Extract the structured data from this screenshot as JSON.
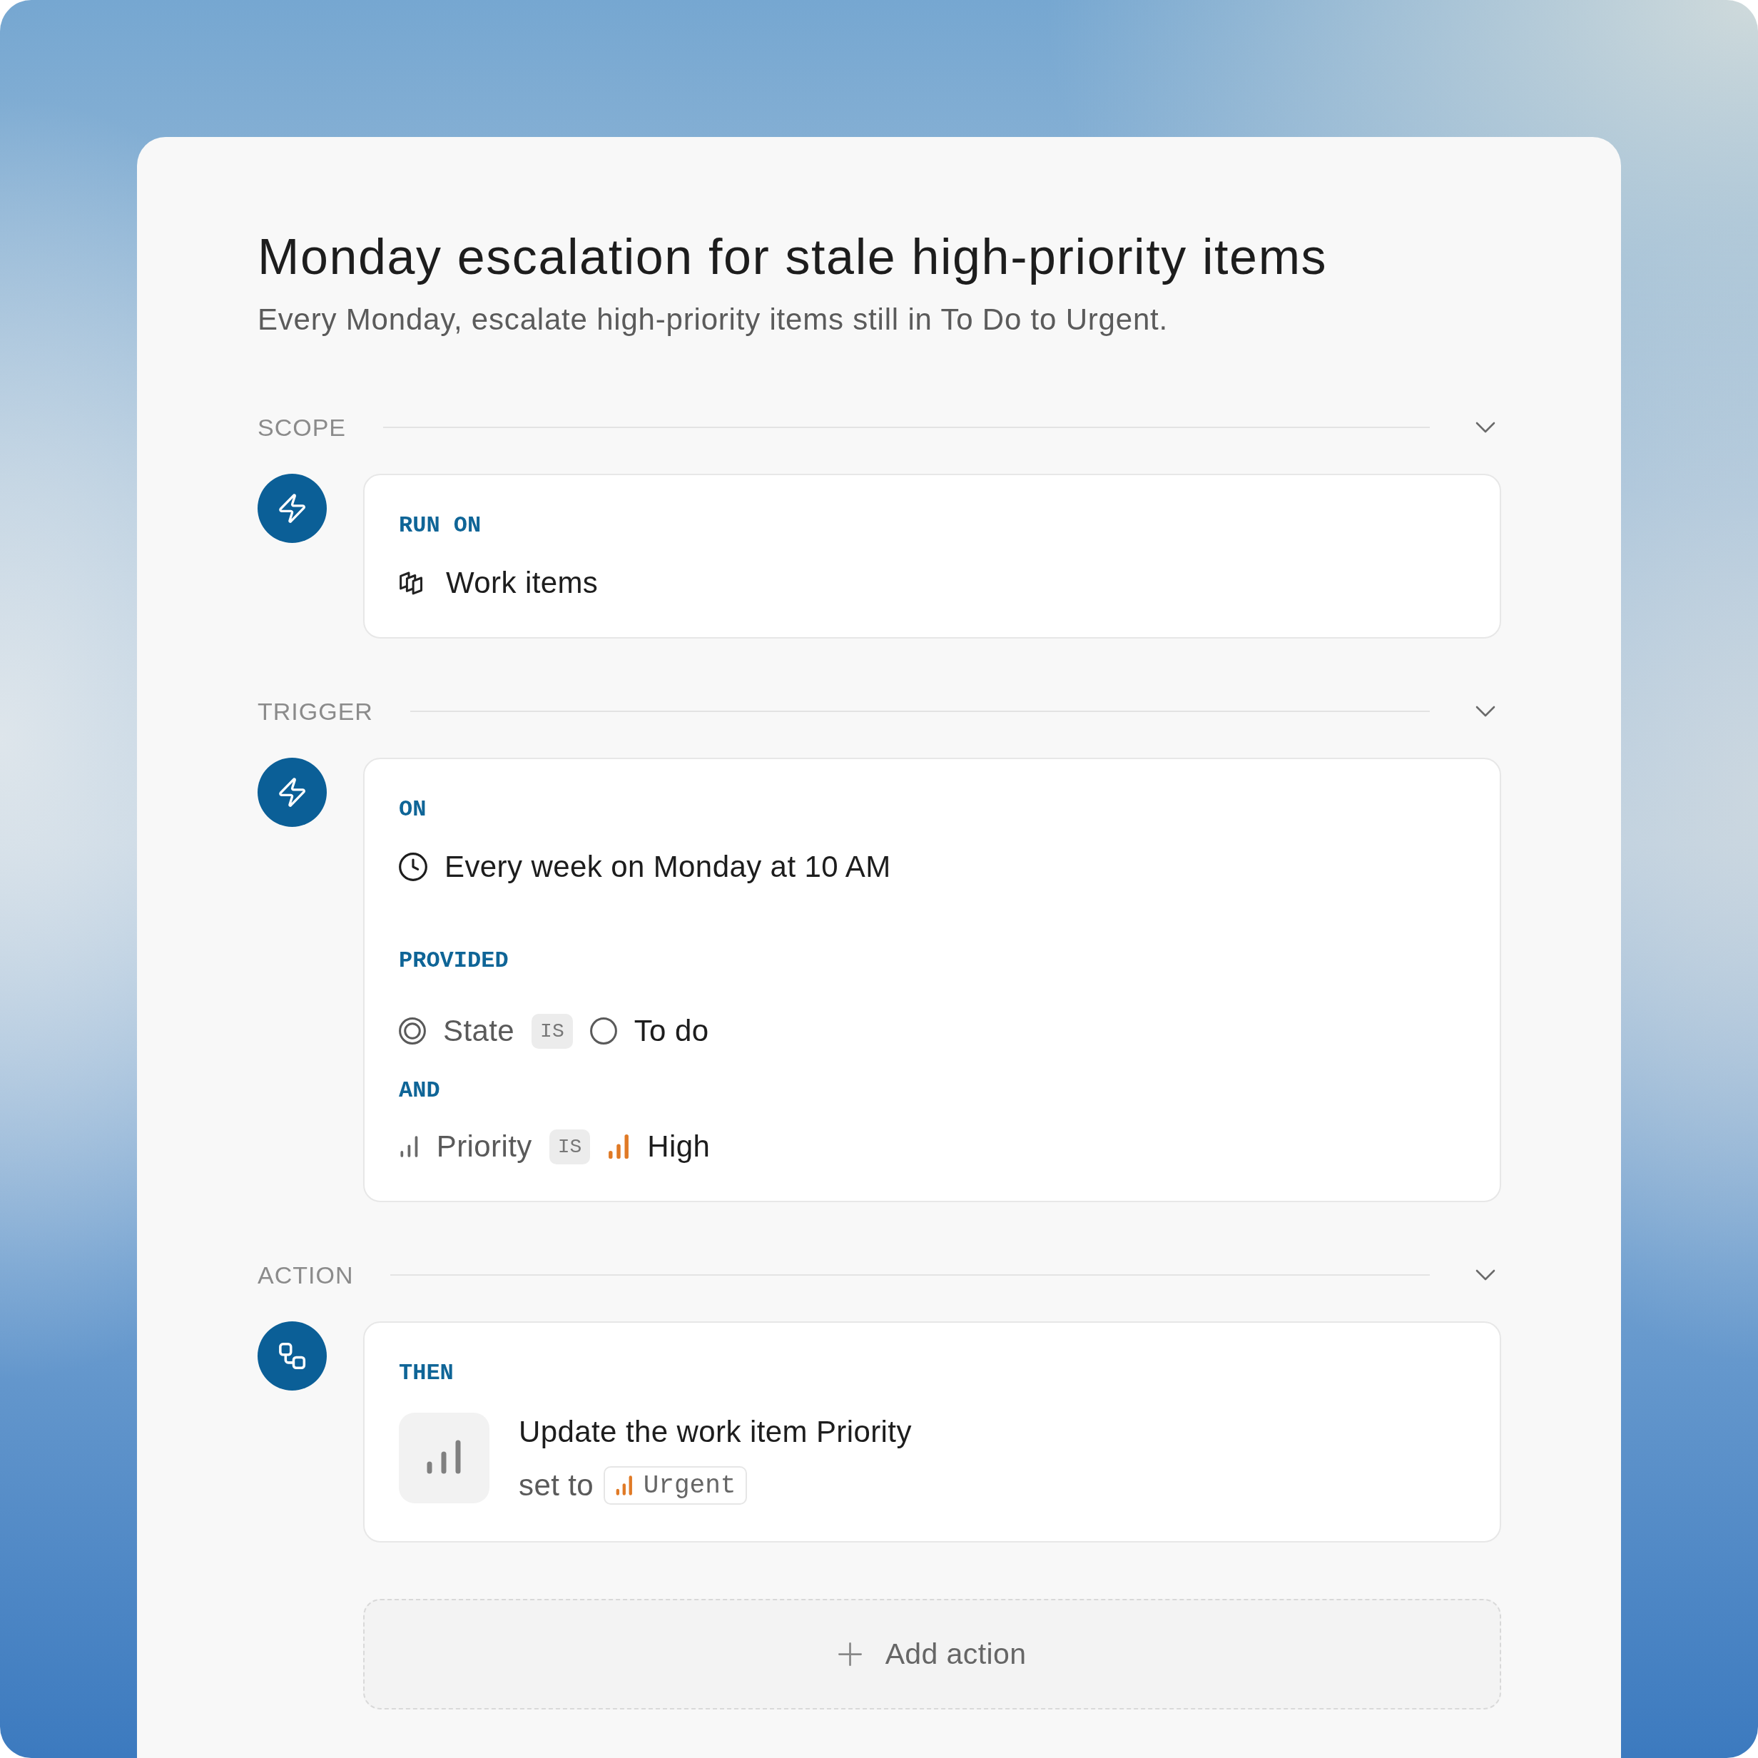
{
  "automation": {
    "title": "Monday escalation for stale high-priority items",
    "description": "Every Monday, escalate high-priority items still in To Do to Urgent."
  },
  "sections": [
    {
      "kind": "scope",
      "heading": "SCOPE",
      "expanded": true,
      "label": "RUN ON",
      "value": "Work items"
    },
    {
      "kind": "trigger",
      "heading": "TRIGGER",
      "expanded": true,
      "label": "ON",
      "schedule": "Every week on Monday at 10 AM",
      "conditions_label": "PROVIDED",
      "conditions": [
        {
          "kind": "state",
          "property": "State",
          "operator": "IS",
          "value": "To do"
        },
        {
          "kind": "priority",
          "joiner": "AND",
          "property": "Priority",
          "operator": "IS",
          "value": "High"
        }
      ]
    },
    {
      "kind": "action",
      "heading": "ACTION",
      "expanded": true,
      "label": "THEN",
      "actions": [
        {
          "kind": "priority",
          "title": "Update the work item Priority",
          "prefix": "set to",
          "value": "Urgent"
        }
      ]
    }
  ],
  "add_button": {
    "label": "Add action"
  }
}
